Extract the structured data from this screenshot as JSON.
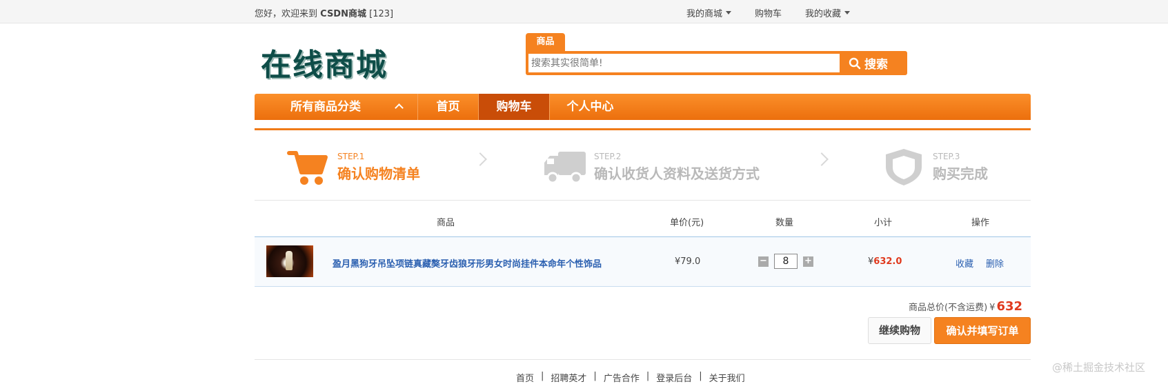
{
  "topbar": {
    "welcome_prefix": "您好，欢迎来到",
    "site_name": "CSDN商城",
    "user_tag": "[123]",
    "links": [
      {
        "label": "我的商城",
        "has_dropdown": true
      },
      {
        "label": "购物车",
        "has_dropdown": false
      },
      {
        "label": "我的收藏",
        "has_dropdown": true
      }
    ]
  },
  "logo": {
    "text": "在线商城"
  },
  "search": {
    "tab_label": "商品",
    "placeholder": "搜索其实很简单!",
    "button_label": "搜索"
  },
  "nav": {
    "all_categories": "所有商品分类",
    "items": [
      {
        "label": "首页",
        "active": false
      },
      {
        "label": "购物车",
        "active": true
      },
      {
        "label": "个人中心",
        "active": false
      }
    ]
  },
  "steps": [
    {
      "step": "STEP.1",
      "label": "确认购物清单",
      "active": true,
      "icon": "cart-icon"
    },
    {
      "step": "STEP.2",
      "label": "确认收货人资料及送货方式",
      "active": false,
      "icon": "truck-icon"
    },
    {
      "step": "STEP.3",
      "label": "购买完成",
      "active": false,
      "icon": "shield-icon"
    }
  ],
  "table": {
    "headers": [
      "商品",
      "单价(元)",
      "数量",
      "小计",
      "操作"
    ],
    "rows": [
      {
        "title": "盈月黑狗牙吊坠项链真藏獒牙齿狼牙形男女时尚挂件本命年个性饰品",
        "price": "¥79.0",
        "quantity": "8",
        "subtotal_prefix": "¥",
        "subtotal": "632.0",
        "actions": [
          "收藏",
          "删除"
        ]
      }
    ]
  },
  "summary": {
    "label": "商品总价(不含运费)",
    "currency": "¥",
    "total": "632",
    "continue_label": "继续购物",
    "confirm_label": "确认并填写订单"
  },
  "footer": {
    "links": [
      "首页",
      "招聘英才",
      "广告合作",
      "登录后台",
      "关于我们"
    ]
  },
  "watermark": "@稀土掘金技术社区",
  "colors": {
    "accent": "#f58220",
    "nav_active": "#c94d08",
    "link": "#2a5fb0",
    "price_red": "#e03a1e"
  }
}
